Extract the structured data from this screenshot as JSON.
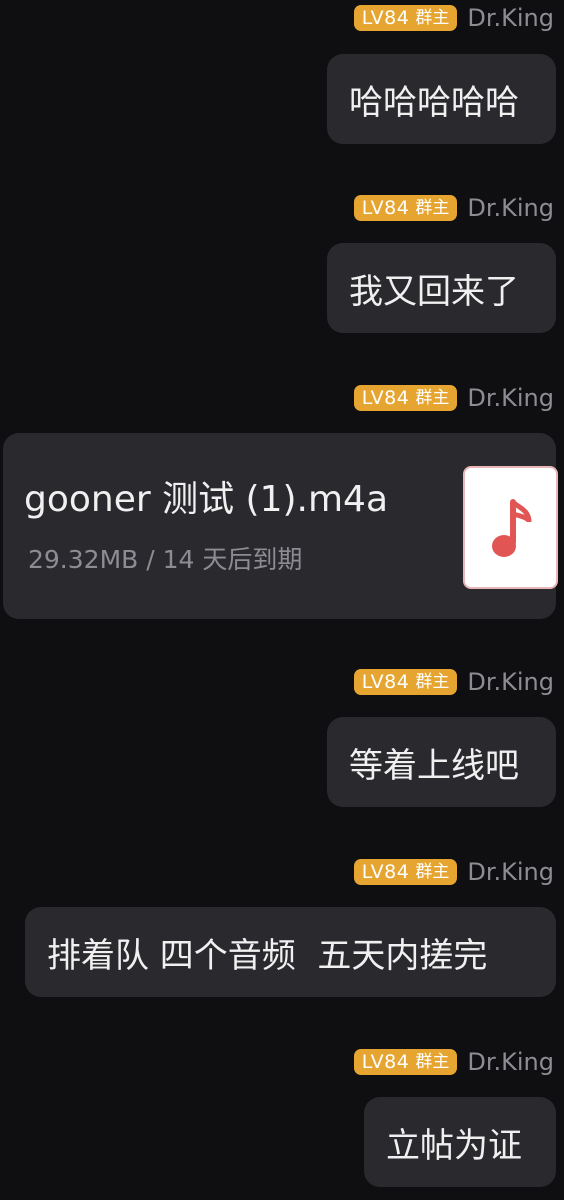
{
  "sender": {
    "level": "LV84",
    "role": "群主",
    "name": "Dr.King",
    "badge_color": "#e6a531"
  },
  "messages": [
    {
      "type": "text",
      "text": "哈哈哈哈哈"
    },
    {
      "type": "text",
      "text": "我又回来了"
    },
    {
      "type": "file",
      "file_name": "gooner 测试 (1).m4a",
      "file_info": "29.32MB / 14 天后到期",
      "icon": "music-note-icon"
    },
    {
      "type": "text",
      "text": "等着上线吧"
    },
    {
      "type": "text",
      "text": "排着队 四个音频  五天内搓完"
    },
    {
      "type": "text",
      "text": "立帖为证"
    }
  ],
  "colors": {
    "background": "#0f0f12",
    "bubble": "#2a2a2e",
    "name": "#8c8c93",
    "music_icon": "#e25555"
  }
}
